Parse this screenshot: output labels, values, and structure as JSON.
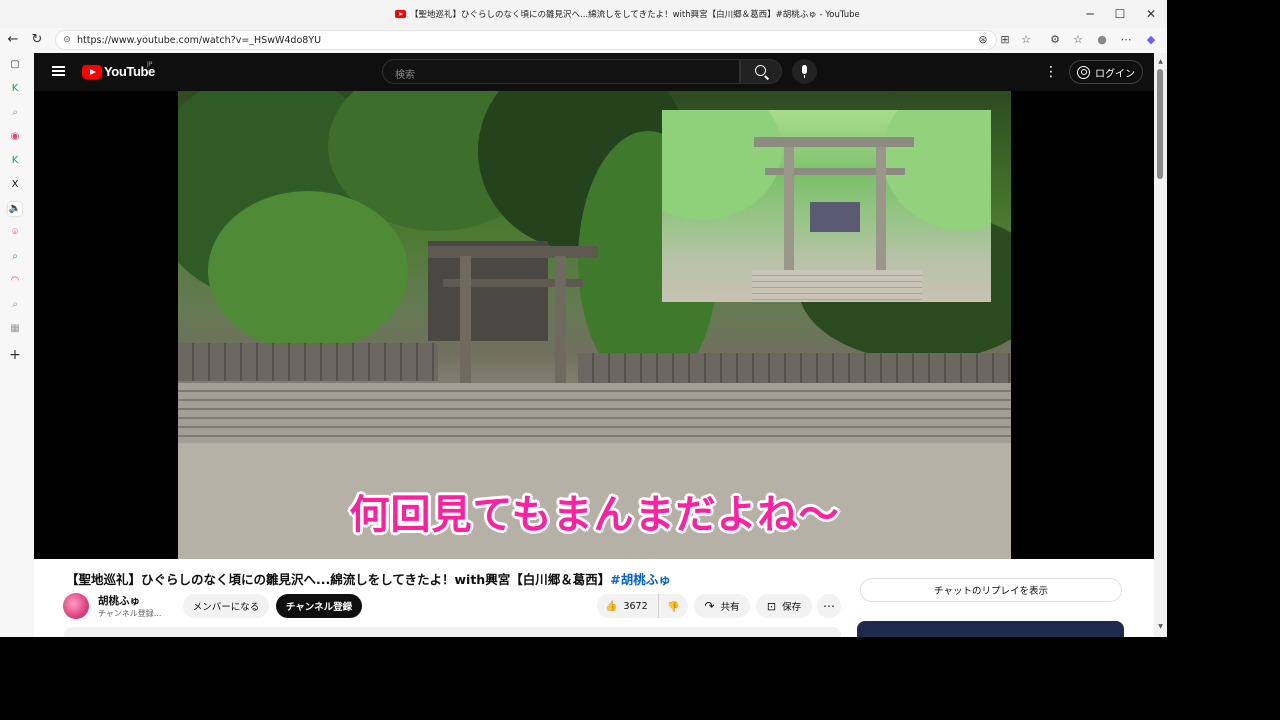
{
  "window": {
    "title": "【聖地巡礼】ひぐらしのなく頃にの雛見沢へ...綿流しをしてきたよ！with興宮【白川郷＆葛西】#胡桃ふゅ - YouTube",
    "minimize_glyph": "─",
    "maximize_glyph": "☐",
    "close_glyph": "✕"
  },
  "browser": {
    "back_glyph": "←",
    "reload_glyph": "↻",
    "url": "https://www.youtube.com/watch?v=_HSwW4do8YU",
    "lock_glyph": "⊝",
    "extensions": [
      "link-icon",
      "reader-icon",
      "star-icon",
      "extension-icon",
      "favorites-icon",
      "profile-icon",
      "more-icon",
      "copilot-icon"
    ],
    "ext_glyphs": [
      "⊛",
      "⊞",
      "☆",
      "⚙",
      "☆",
      "●",
      "⋯",
      "◆"
    ]
  },
  "sidebar": {
    "items": [
      {
        "name": "tabs-icon",
        "glyph": "▢",
        "color": "#333333"
      },
      {
        "name": "app-k-icon",
        "glyph": "K",
        "color": "#1fa14a"
      },
      {
        "name": "search-small-icon",
        "glyph": "⌕",
        "color": "#999999"
      },
      {
        "name": "app-circle-icon",
        "glyph": "◉",
        "color": "#e0457b"
      },
      {
        "name": "app-k2-icon",
        "glyph": "K",
        "color": "#1fa14a"
      },
      {
        "name": "x-icon",
        "glyph": "X",
        "color": "#111111"
      },
      {
        "name": "speaker-icon",
        "glyph": "🔈",
        "color": "#333333"
      },
      {
        "name": "pin-icon",
        "glyph": "⌾",
        "color": "#e0457b"
      },
      {
        "name": "search-small-icon-2",
        "glyph": "⌕",
        "color": "#2d9a57"
      },
      {
        "name": "app-arc-icon",
        "glyph": "◠",
        "color": "#d04a6b"
      },
      {
        "name": "search-small-icon-3",
        "glyph": "⌕",
        "color": "#999999"
      },
      {
        "name": "app-grid-icon",
        "glyph": "▦",
        "color": "#999999"
      },
      {
        "name": "add-icon",
        "glyph": "+",
        "color": "#333333"
      }
    ]
  },
  "youtube": {
    "logo_text": "YouTube",
    "logo_region": "JP",
    "search_placeholder": "検索",
    "login_label": "ログイン",
    "more_glyph": "⋮"
  },
  "video": {
    "subtitle": "何回見てもまんまだよね～"
  },
  "meta": {
    "title_main": "【聖地巡礼】ひぐらしのなく頃にの雛見沢へ...綿流しをしてきたよ！with興宮【白川郷＆葛西】",
    "title_tag": "#胡桃ふゅ",
    "channel_name": "胡桃ふゅ",
    "channel_subs": "チャンネル登録...",
    "member_label": "メンバーになる",
    "subscribe_label": "チャンネル登録",
    "like_count": "3672",
    "like_glyph": "👍",
    "dislike_glyph": "👎",
    "share_label": "共有",
    "share_glyph": "↷",
    "save_label": "保存",
    "save_glyph": "⊡",
    "more_glyph": "⋯",
    "chat_replay_label": "チャットのリプレイを表示"
  },
  "scrollbar": {
    "up_glyph": "▲",
    "down_glyph": "▼"
  }
}
